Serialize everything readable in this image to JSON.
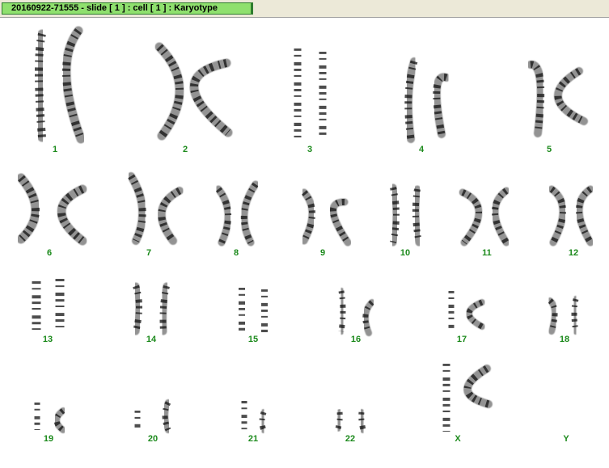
{
  "window": {
    "title": "20160922-71555 - slide [ 1 ] : cell [ 1 ] : Karyotype"
  },
  "colors": {
    "title_bg": "#8fe06e",
    "label": "#1c8a1c",
    "chromatid": "#3a3a3a"
  },
  "chromosomes": [
    {
      "label": "1"
    },
    {
      "label": "2"
    },
    {
      "label": "3"
    },
    {
      "label": "4"
    },
    {
      "label": "5"
    },
    {
      "label": "6"
    },
    {
      "label": "7"
    },
    {
      "label": "8"
    },
    {
      "label": "9"
    },
    {
      "label": "10"
    },
    {
      "label": "11"
    },
    {
      "label": "12"
    },
    {
      "label": "13"
    },
    {
      "label": "14"
    },
    {
      "label": "15"
    },
    {
      "label": "16"
    },
    {
      "label": "17"
    },
    {
      "label": "18"
    },
    {
      "label": "19"
    },
    {
      "label": "20"
    },
    {
      "label": "21"
    },
    {
      "label": "22"
    },
    {
      "label": "X"
    },
    {
      "label": "Y"
    }
  ]
}
